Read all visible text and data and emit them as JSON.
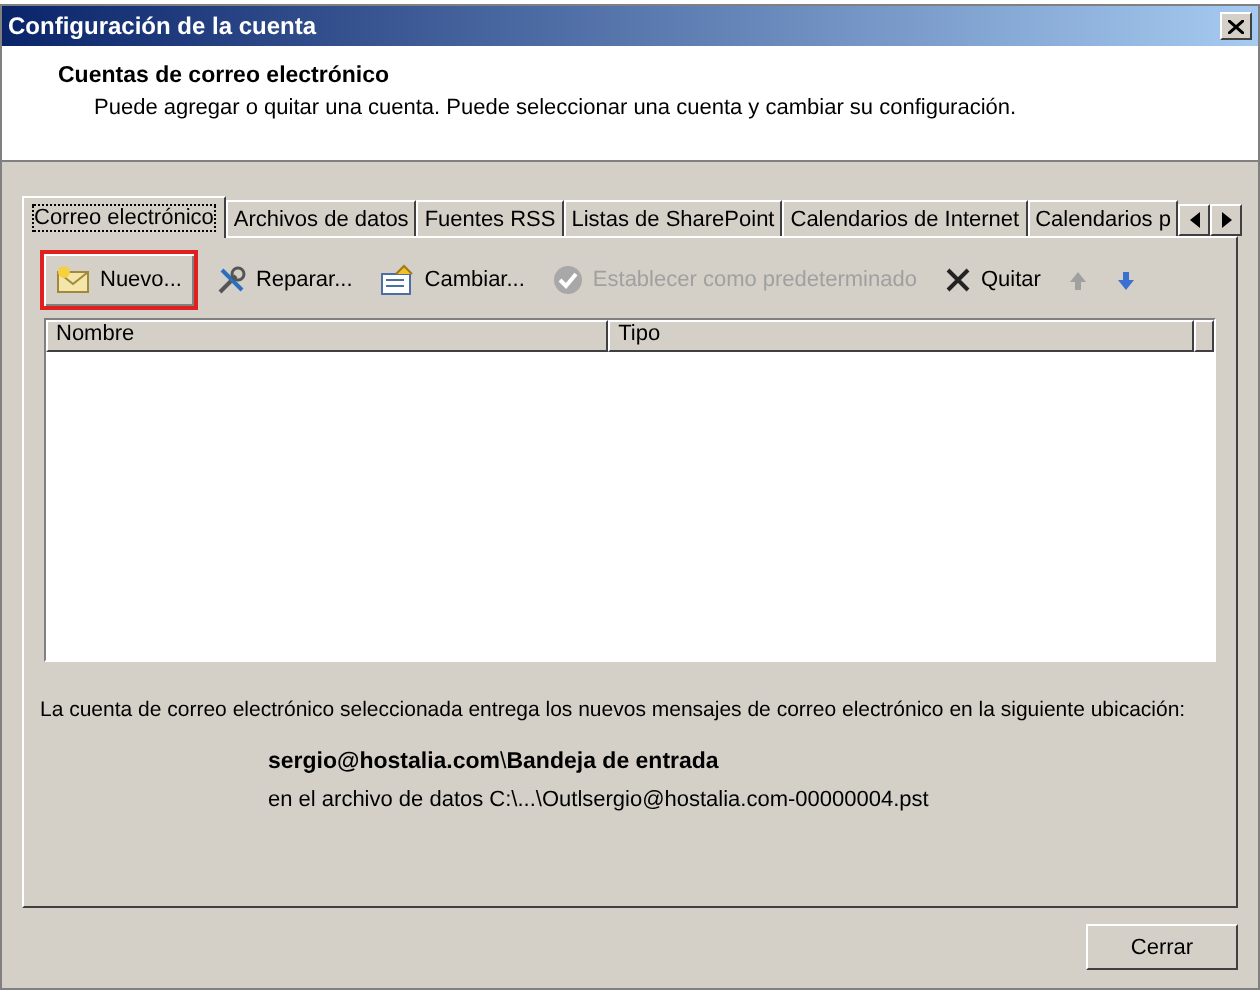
{
  "window": {
    "title": "Configuración de la cuenta"
  },
  "header": {
    "title": "Cuentas de correo electrónico",
    "subtitle": "Puede agregar o quitar una cuenta. Puede seleccionar una cuenta y cambiar su configuración."
  },
  "tabs": [
    {
      "label": "Correo electrónico",
      "selected": true
    },
    {
      "label": "Archivos de datos",
      "selected": false
    },
    {
      "label": "Fuentes RSS",
      "selected": false
    },
    {
      "label": "Listas de SharePoint",
      "selected": false
    },
    {
      "label": "Calendarios de Internet",
      "selected": false
    },
    {
      "label": "Calendarios p",
      "selected": false
    }
  ],
  "toolbar": [
    {
      "kind": "new",
      "label": "Nuevo...",
      "disabled": false,
      "highlighted": true
    },
    {
      "kind": "repair",
      "label": "Reparar...",
      "disabled": false,
      "highlighted": false
    },
    {
      "kind": "change",
      "label": "Cambiar...",
      "disabled": false,
      "highlighted": false
    },
    {
      "kind": "default",
      "label": "Establecer como predeterminado",
      "disabled": true,
      "highlighted": false
    },
    {
      "kind": "remove",
      "label": "Quitar",
      "disabled": false,
      "highlighted": false
    },
    {
      "kind": "up",
      "disabled": true,
      "highlighted": false
    },
    {
      "kind": "down",
      "disabled": false,
      "highlighted": false
    }
  ],
  "table": {
    "columns": [
      "Nombre",
      "Tipo"
    ]
  },
  "info": {
    "description": "La cuenta de correo electrónico seleccionada entrega los nuevos mensajes de correo electrónico en la siguiente ubicación:",
    "location": "**sergio@hostalia.com**\\**Bandeja de entrada**",
    "file": "en el archivo de datos C:\\...\\Outlsergio@hostalia.com-00000004.pst"
  },
  "buttons": [
    {
      "label": "Cerrar"
    }
  ]
}
